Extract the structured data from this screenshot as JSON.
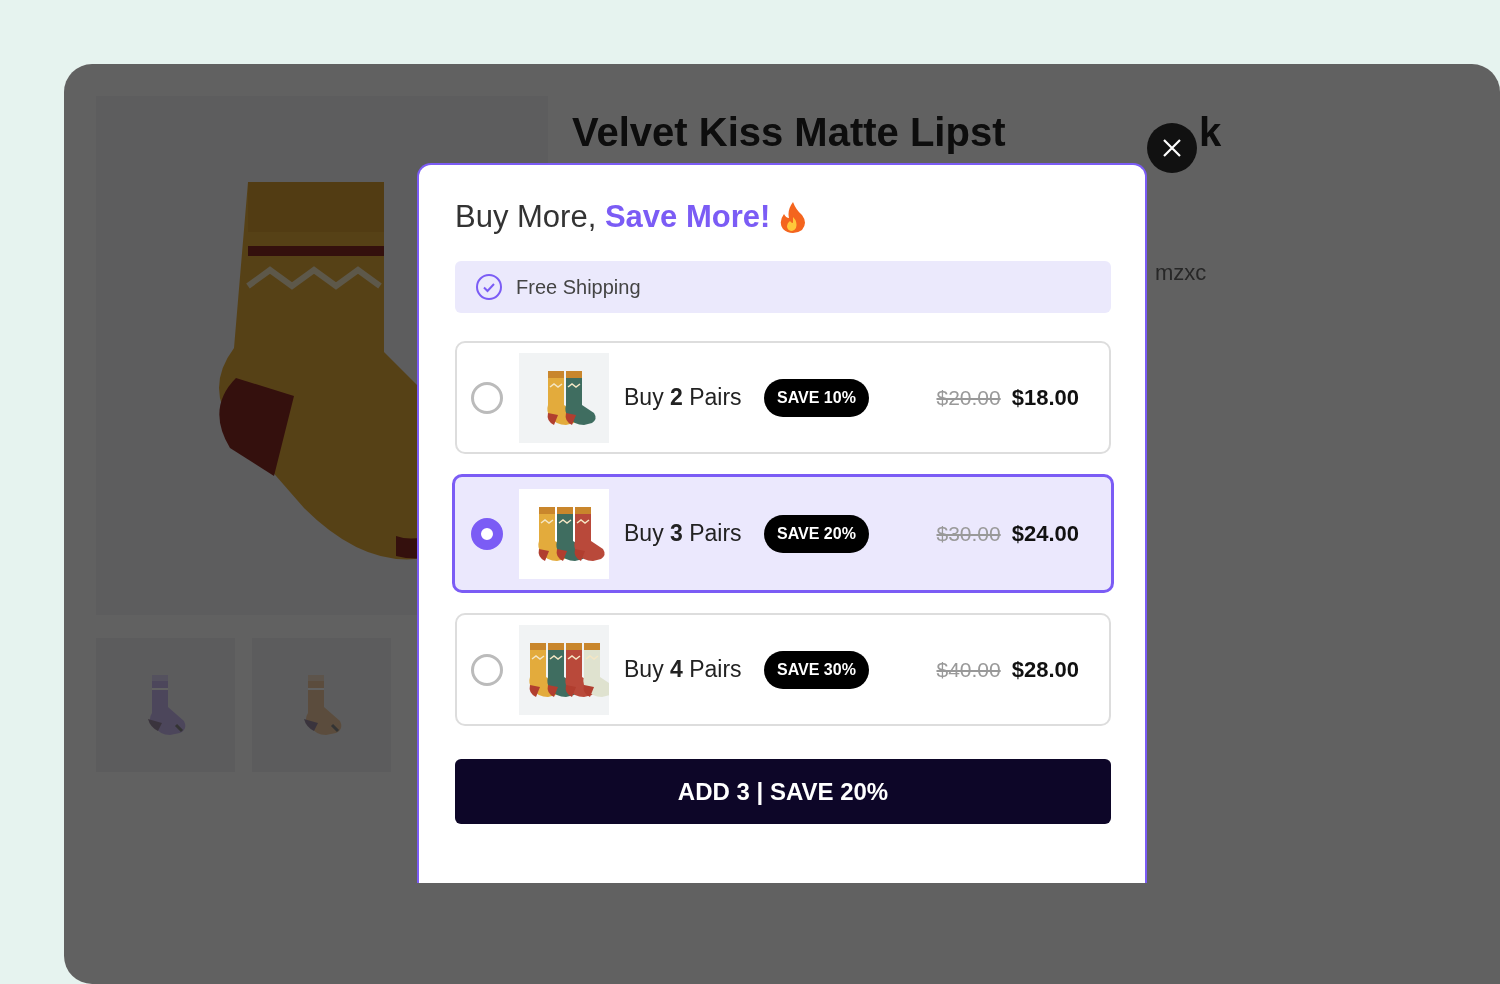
{
  "product_page": {
    "title": "Velvet Kiss Matte Lipst",
    "title_end": "k",
    "subtitle": "mzxc"
  },
  "modal": {
    "heading": "Buy More, **Save More!**",
    "perk": "Free Shipping",
    "options": [
      {
        "label": "Buy **2** Pairs",
        "badge": "SAVE 10%",
        "original_price": "$20.00",
        "price": "$18.00",
        "selected": false
      },
      {
        "label": "Buy **3** Pairs",
        "badge": "SAVE 20%",
        "original_price": "$30.00",
        "price": "$24.00",
        "selected": true
      },
      {
        "label": "Buy **4** Pairs",
        "badge": "SAVE 30%",
        "original_price": "$40.00",
        "price": "$28.00",
        "selected": false
      }
    ],
    "button": "ADD 3 | SAVE 20%"
  }
}
